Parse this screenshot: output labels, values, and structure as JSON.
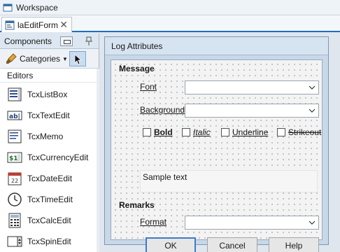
{
  "window": {
    "title": "Workspace"
  },
  "tabs": [
    {
      "label": "laEditForm",
      "close": "✕"
    }
  ],
  "components": {
    "title": "Components",
    "categories_label": "Categories",
    "section": "Editors",
    "items": [
      {
        "label": "TcxListBox",
        "icon": "listbox-icon"
      },
      {
        "label": "TcxTextEdit",
        "icon": "textedit-icon"
      },
      {
        "label": "TcxMemo",
        "icon": "memo-icon"
      },
      {
        "label": "TcxCurrencyEdit",
        "icon": "currency-icon"
      },
      {
        "label": "TcxDateEdit",
        "icon": "calendar-icon"
      },
      {
        "label": "TcxTimeEdit",
        "icon": "clock-icon"
      },
      {
        "label": "TcxCalcEdit",
        "icon": "calculator-icon"
      },
      {
        "label": "TcxSpinEdit",
        "icon": "spin-icon"
      }
    ]
  },
  "form": {
    "title": "Log Attributes",
    "message_group": "Message",
    "font_label": "Font",
    "background_label": "Background",
    "font_value": "",
    "background_value": "",
    "checks": [
      {
        "label": "Bold",
        "checked": false
      },
      {
        "label": "Italic",
        "checked": false
      },
      {
        "label": "Underline",
        "checked": false
      },
      {
        "label": "Strikeout",
        "checked": false
      }
    ],
    "sample_text": "Sample text",
    "remarks_group": "Remarks",
    "format_label": "Format",
    "format_value": "",
    "ok": "OK",
    "cancel": "Cancel",
    "help": "Help"
  },
  "colors": {
    "accent": "#1f6fbf",
    "form_bg": "#c8d8e8",
    "selected_tool": "#c9dcf0"
  }
}
